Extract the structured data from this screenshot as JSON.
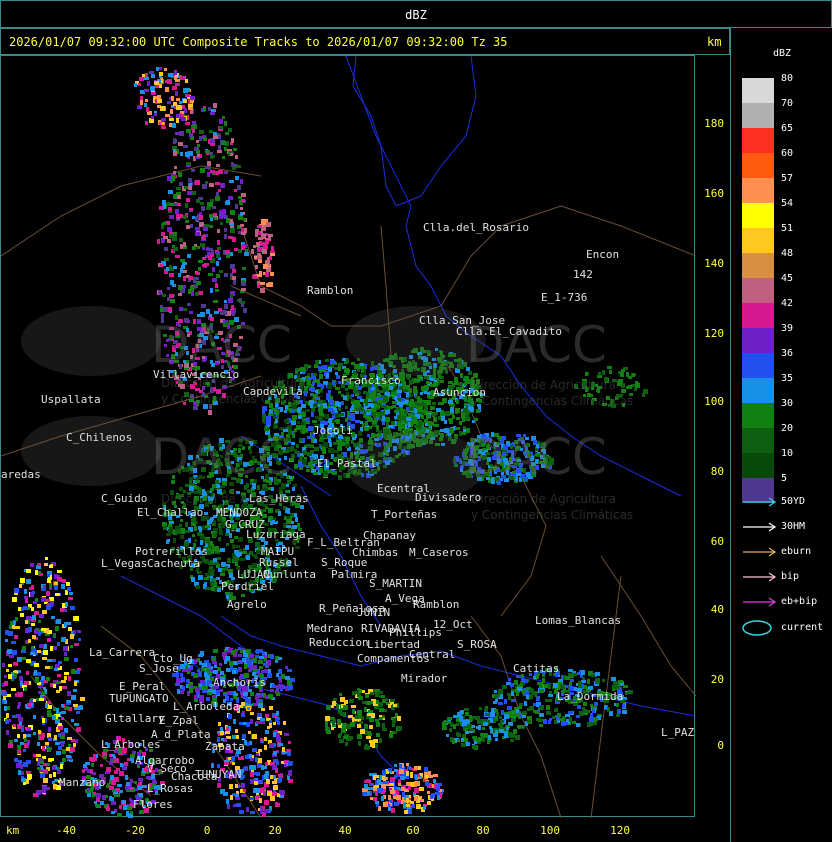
{
  "window_title": "dBZ",
  "header": {
    "text": "2026/01/07 09:32:00 UTC Composite Tracks to 2026/01/07 09:32:00 Tz 35",
    "km_top": "km",
    "km_bottom": "km"
  },
  "y_axis_ticks": [
    "180",
    "160",
    "140",
    "120",
    "100",
    "80",
    "60",
    "40",
    "20",
    "0"
  ],
  "x_axis_ticks": [
    "-40",
    "-20",
    "0",
    "20",
    "40",
    "60",
    "80",
    "100",
    "120"
  ],
  "legend": {
    "title": "dBZ",
    "levels": [
      {
        "label": "80",
        "color": "#d8d8d8"
      },
      {
        "label": "70",
        "color": "#b0b0b0"
      },
      {
        "label": "65",
        "color": "#ff3020"
      },
      {
        "label": "60",
        "color": "#ff5a10"
      },
      {
        "label": "57",
        "color": "#ff9050"
      },
      {
        "label": "54",
        "color": "#ffff00"
      },
      {
        "label": "51",
        "color": "#ffc820"
      },
      {
        "label": "48",
        "color": "#d89040"
      },
      {
        "label": "45",
        "color": "#c06080"
      },
      {
        "label": "42",
        "color": "#d81890"
      },
      {
        "label": "39",
        "color": "#7020c8"
      },
      {
        "label": "36",
        "color": "#2050f0"
      },
      {
        "label": "35",
        "color": "#1890e8"
      },
      {
        "label": "30",
        "color": "#108010"
      },
      {
        "label": "20",
        "color": "#0c6010"
      },
      {
        "label": "10",
        "color": "#084808"
      },
      {
        "label": "5",
        "color": "#503890"
      }
    ],
    "tracks": [
      {
        "label": "50YD",
        "color": "#40d0e0"
      },
      {
        "label": "30HM",
        "color": "#ffffff"
      },
      {
        "label": "eburn",
        "color": "#f0b060"
      },
      {
        "label": "bip",
        "color": "#ffc0d0"
      },
      {
        "label": "eb+bip",
        "color": "#e040e0"
      }
    ],
    "current_label": "current",
    "current_color": "#40d0e0"
  },
  "watermark": {
    "brand": "DACC",
    "line1": "Dirección de Agricultura",
    "line2": "y Contingencias Climáticas"
  },
  "places": [
    {
      "name": "Clla.del_Rosario"
    },
    {
      "name": "Encon"
    },
    {
      "name": "E_1-736"
    },
    {
      "name": "142"
    },
    {
      "name": "Ramblon"
    },
    {
      "name": "Clla.San_Jose"
    },
    {
      "name": "Clla.El_Cavadito"
    },
    {
      "name": "Villavicencio"
    },
    {
      "name": "Capdevila"
    },
    {
      "name": "Francisco"
    },
    {
      "name": "Jocoli"
    },
    {
      "name": "Asuncion"
    },
    {
      "name": "Uspallata"
    },
    {
      "name": "C_Chilenos"
    },
    {
      "name": "aredas"
    },
    {
      "name": "El_Pastal"
    },
    {
      "name": "C_Guido"
    },
    {
      "name": "El_Challao"
    },
    {
      "name": "MENDOZA"
    },
    {
      "name": "G_CRUZ"
    },
    {
      "name": "Las_Heras"
    },
    {
      "name": "Ecentral"
    },
    {
      "name": "Divisadero"
    },
    {
      "name": "T_Porteñas"
    },
    {
      "name": "Chapanay"
    },
    {
      "name": "Luzuriaga"
    },
    {
      "name": "F_L_Beltran"
    },
    {
      "name": "Chimbas"
    },
    {
      "name": "M_Caseros"
    },
    {
      "name": "Potrerillos"
    },
    {
      "name": "L_Vegas"
    },
    {
      "name": "Cacheuta"
    },
    {
      "name": "MAIPU"
    },
    {
      "name": "Russel"
    },
    {
      "name": "S_Roque"
    },
    {
      "name": "Palmira"
    },
    {
      "name": "LUJAN"
    },
    {
      "name": "Cunlunta"
    },
    {
      "name": "S_MARTIN"
    },
    {
      "name": "Perdriel"
    },
    {
      "name": "A_Vega"
    },
    {
      "name": "Ramblon"
    },
    {
      "name": "Agrelo"
    },
    {
      "name": "R_Peñalosa"
    },
    {
      "name": "JUNIN"
    },
    {
      "name": "Medrano"
    },
    {
      "name": "RIVADAVIA"
    },
    {
      "name": "Phillips"
    },
    {
      "name": "12_Oct"
    },
    {
      "name": "Lomas_Blancas"
    },
    {
      "name": "S_ROSA"
    },
    {
      "name": "La_Carrera"
    },
    {
      "name": "Cto_Ug"
    },
    {
      "name": "S_Jose"
    },
    {
      "name": "Reduccion"
    },
    {
      "name": "Libertad"
    },
    {
      "name": "Compamentos"
    },
    {
      "name": "Central"
    },
    {
      "name": "Catitas"
    },
    {
      "name": "E_Peral"
    },
    {
      "name": "TUPUNGATO"
    },
    {
      "name": "Anchoris"
    },
    {
      "name": "Mirador"
    },
    {
      "name": "La_Dormida"
    },
    {
      "name": "L_Arboleda"
    },
    {
      "name": "Gltallary"
    },
    {
      "name": "E_Zpal"
    },
    {
      "name": "L_Arboles"
    },
    {
      "name": "A_d_Plata"
    },
    {
      "name": "Zapata"
    },
    {
      "name": "L_PAZ"
    },
    {
      "name": "Algarrobo"
    },
    {
      "name": "V_Seco"
    },
    {
      "name": "Chacota"
    },
    {
      "name": "Manzano"
    },
    {
      "name": "L_Rosas"
    },
    {
      "name": "TUNUYAN"
    },
    {
      "name": "Flores"
    }
  ]
}
